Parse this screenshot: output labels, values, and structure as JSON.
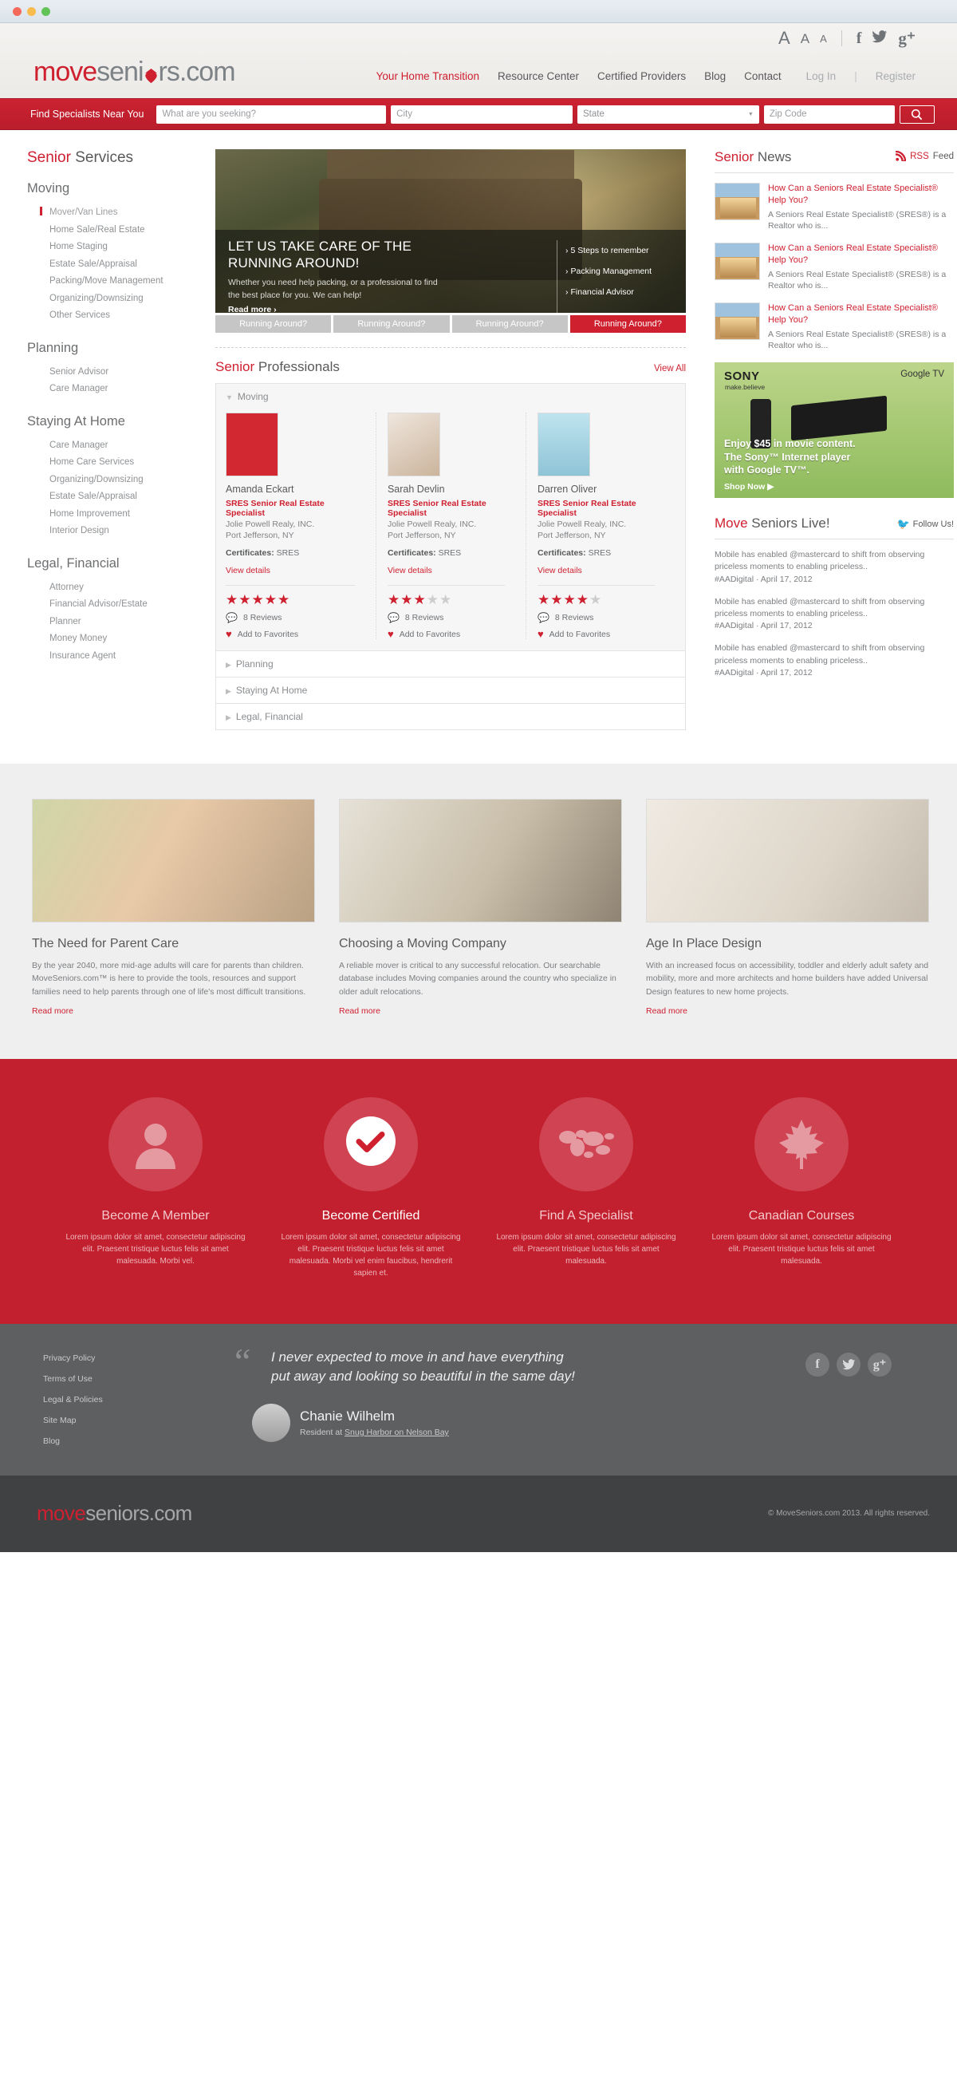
{
  "browser": {
    "dots": [
      "close",
      "minimize",
      "zoom"
    ]
  },
  "utility": {
    "font_sizes": [
      "A",
      "A",
      "A"
    ],
    "social": [
      {
        "name": "facebook",
        "glyph": "f"
      },
      {
        "name": "twitter",
        "glyph": "ᴠ"
      },
      {
        "name": "google-plus",
        "glyph": "g"
      }
    ]
  },
  "brand": {
    "part1": "move",
    "part2": "seni",
    "part3": "rs.com"
  },
  "nav": [
    {
      "label": "Your Home Transition",
      "state": "active"
    },
    {
      "label": "Resource Center",
      "state": "default"
    },
    {
      "label": "Certified Providers",
      "state": "default"
    },
    {
      "label": "Blog",
      "state": "default"
    },
    {
      "label": "Contact",
      "state": "default"
    },
    {
      "label": "Log In",
      "state": "muted"
    },
    {
      "label": "Register",
      "state": "muted"
    }
  ],
  "nav_separator": "|",
  "search": {
    "label": "Find Specialists Near You",
    "what_placeholder": "What are you seeking?",
    "city_placeholder": "City",
    "state_value": "State",
    "zip_placeholder": "Zip Code",
    "button_icon": "search-icon"
  },
  "sidebar": {
    "title_red": "Senior",
    "title_rest": " Services",
    "groups": [
      {
        "name": "Moving",
        "items": [
          {
            "label": "Mover/Van Lines",
            "active": true
          },
          {
            "label": "Home Sale/Real Estate",
            "active": false
          },
          {
            "label": "Home Staging",
            "active": false
          },
          {
            "label": "Estate Sale/Appraisal",
            "active": false
          },
          {
            "label": "Packing/Move Management",
            "active": false
          },
          {
            "label": "Organizing/Downsizing",
            "active": false
          },
          {
            "label": "Other Services",
            "active": false
          }
        ]
      },
      {
        "name": "Planning",
        "items": [
          {
            "label": "Senior Advisor",
            "active": false
          },
          {
            "label": "Care Manager",
            "active": false
          }
        ]
      },
      {
        "name": "Staying At Home",
        "items": [
          {
            "label": "Care Manager",
            "active": false
          },
          {
            "label": "Home Care Services",
            "active": false
          },
          {
            "label": "Organizing/Downsizing",
            "active": false
          },
          {
            "label": "Estate Sale/Appraisal",
            "active": false
          },
          {
            "label": "Home Improvement",
            "active": false
          },
          {
            "label": "Interior Design",
            "active": false
          }
        ]
      },
      {
        "name": "Legal, Financial",
        "items": [
          {
            "label": "Attorney",
            "active": false
          },
          {
            "label": "Financial Advisor/Estate",
            "active": false
          },
          {
            "label": "Planner",
            "active": false
          },
          {
            "label": "Money Money",
            "active": false
          },
          {
            "label": "Insurance Agent",
            "active": false
          }
        ]
      }
    ]
  },
  "hero": {
    "headline_line1": "LET US TAKE CARE OF THE",
    "headline_line2": "RUNNING AROUND!",
    "body": "Whether you need help packing, or a professional to find the best place for you. We can help!",
    "read_more": "Read more ›",
    "links": [
      "5 Steps to remember",
      "Packing Management",
      "Financial Advisor"
    ],
    "tabs": [
      {
        "label": "Running Around?",
        "active": false
      },
      {
        "label": "Running Around?",
        "active": false
      },
      {
        "label": "Running Around?",
        "active": false
      },
      {
        "label": "Running Around?",
        "active": true
      }
    ]
  },
  "professionals": {
    "title_red": "Senior",
    "title_rest": " Professionals",
    "view_all": "View All",
    "open_section": "Moving",
    "closed_sections": [
      "Planning",
      "Staying At Home",
      "Legal, Financial"
    ],
    "cards": [
      {
        "name": "Amanda Eckart",
        "title": "SRES Senior Real Estate Specialist",
        "company": "Jolie Powell Realy, INC.",
        "location": "Port Jefferson, NY",
        "cert_label": "Certificates:",
        "cert_value": "SRES",
        "details": "View details",
        "rating": 5,
        "reviews": "8 Reviews",
        "favorite": "Add to Favorites"
      },
      {
        "name": "Sarah Devlin",
        "title": "SRES Senior Real Estate Specialist",
        "company": "Jolie Powell Realy, INC.",
        "location": "Port Jefferson, NY",
        "cert_label": "Certificates:",
        "cert_value": "SRES",
        "details": "View details",
        "rating": 3,
        "reviews": "8 Reviews",
        "favorite": "Add to Favorites"
      },
      {
        "name": "Darren Oliver",
        "title": "SRES Senior Real Estate Specialist",
        "company": "Jolie Powell Realy, INC.",
        "location": "Port Jefferson, NY",
        "cert_label": "Certificates:",
        "cert_value": "SRES",
        "details": "View details",
        "rating": 4,
        "reviews": "8 Reviews",
        "favorite": "Add to Favorites"
      }
    ]
  },
  "news": {
    "title_red": "Senior",
    "title_rest": " News",
    "rss_red": "RSS",
    "rss_rest": " Feed",
    "items": [
      {
        "title": "How Can a Seniors Real Estate Specialist® Help You?",
        "excerpt": "A Seniors Real Estate Specialist® (SRES®) is a Realtor who is..."
      },
      {
        "title": "How Can a Seniors Real Estate Specialist® Help You?",
        "excerpt": "A Seniors Real Estate Specialist® (SRES®) is a Realtor who is..."
      },
      {
        "title": "How Can a Seniors Real Estate Specialist® Help You?",
        "excerpt": "A Seniors Real Estate Specialist® (SRES®) is a Realtor who is..."
      }
    ]
  },
  "ad": {
    "brand": "SONY",
    "tagline": "make.believe",
    "partner": "Google TV",
    "headline_1": "Enjoy $45 in movie content.",
    "headline_2": "The Sony™ Internet player",
    "headline_3": "with Google TV™.",
    "cta": "Shop Now ▶"
  },
  "live": {
    "title_red": "Move",
    "title_rest": " Seniors Live!",
    "follow": "Follow Us!",
    "tweets": [
      {
        "text": "Mobile has enabled @mastercard to shift from observing priceless moments to enabling priceless..",
        "meta": "#AADigital · April 17, 2012"
      },
      {
        "text": "Mobile has enabled @mastercard to shift from observing priceless moments to enabling priceless..",
        "meta": "#AADigital · April 17, 2012"
      },
      {
        "text": "Mobile has enabled @mastercard to shift from observing priceless moments to enabling priceless..",
        "meta": "#AADigital · April 17, 2012"
      }
    ]
  },
  "articles": [
    {
      "title": "The Need for Parent Care",
      "body": "By the year 2040, more mid-age adults will care for parents than children. MoveSeniors.com™ is here to provide the tools, resources and support families need to help parents through one of life's most difficult transitions.",
      "read_more": "Read more"
    },
    {
      "title": "Choosing a Moving Company",
      "body": "A reliable mover is critical to any successful relocation. Our searchable database includes Moving companies around the country who specialize in older adult relocations.",
      "read_more": "Read more"
    },
    {
      "title": "Age In Place Design",
      "body": "With an increased focus on accessibility, toddler and elderly adult safety and mobility, more and more architects and home builders have added Universal Design features to new home projects.",
      "read_more": "Read more"
    }
  ],
  "features": [
    {
      "icon": "person-icon",
      "title": "Become A Member",
      "body": "Lorem ipsum dolor sit amet, consectetur adipiscing elit. Praesent tristique luctus felis sit amet malesuada. Morbi vel.",
      "highlight": false
    },
    {
      "icon": "certified-badge-icon",
      "title": "Become Certified",
      "body": "Lorem ipsum dolor sit amet, consectetur adipiscing elit. Praesent tristique luctus felis sit amet malesuada. Morbi vel enim faucibus, hendrerit sapien et.",
      "highlight": true
    },
    {
      "icon": "globe-icon",
      "title": "Find A Specialist",
      "body": "Lorem ipsum dolor sit amet, consectetur adipiscing elit. Praesent tristique luctus felis sit amet malesuada.",
      "highlight": false
    },
    {
      "icon": "maple-leaf-icon",
      "title": "Canadian Courses",
      "body": "Lorem ipsum dolor sit amet, consectetur adipiscing elit. Praesent tristique luctus felis sit amet malesuada.",
      "highlight": false
    }
  ],
  "footer": {
    "links": [
      "Privacy Policy",
      "Terms of Use",
      "Legal & Policies",
      "Site Map",
      "Blog"
    ],
    "quote_line1": "I never expected to move in and have everything",
    "quote_line2": "put away and looking so beautiful in the same day!",
    "person_name": "Chanie Wilhelm",
    "person_role_prefix": "Resident at ",
    "person_role_link": "Snug Harbor on Nelson Bay",
    "social": [
      {
        "name": "facebook",
        "glyph": "f"
      },
      {
        "name": "twitter",
        "glyph": "ᴠ"
      },
      {
        "name": "google-plus",
        "glyph": "g"
      }
    ]
  },
  "bottom": {
    "brand_move": "move",
    "brand_rest": "seniors.com",
    "copyright": "© MoveSeniors.com 2013. All rights reserved."
  }
}
